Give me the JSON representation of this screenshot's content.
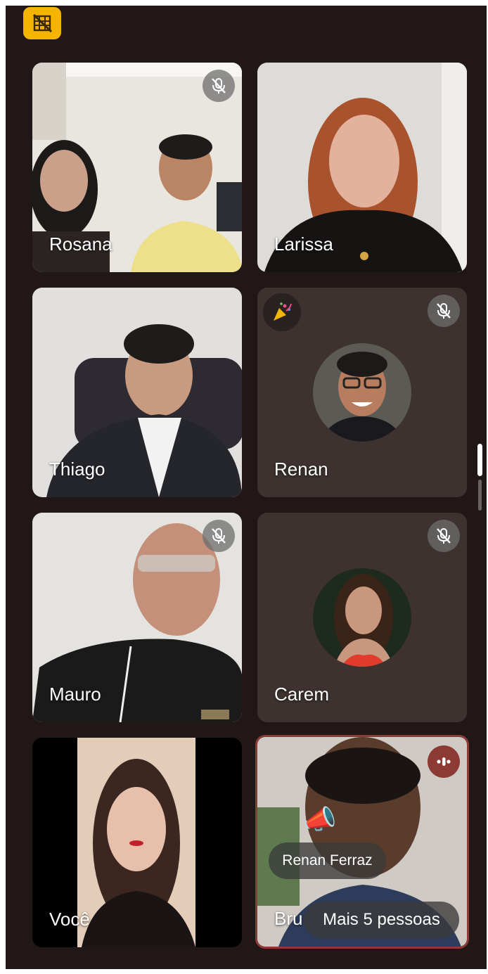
{
  "participants": [
    {
      "name": "Rosana",
      "muted": true
    },
    {
      "name": "Larissa",
      "muted": false
    },
    {
      "name": "Thiago",
      "muted": false
    },
    {
      "name": "Renan",
      "muted": true
    },
    {
      "name": "Mauro",
      "muted": true
    },
    {
      "name": "Carem",
      "muted": true
    },
    {
      "name": "Você",
      "muted": false
    },
    {
      "name": "Bru",
      "muted": false,
      "speaking": true
    }
  ],
  "reaction": {
    "sender": "Renan Ferraz",
    "emoji": "📣"
  },
  "more_people": "Mais 5 pessoas",
  "icons": {
    "top_badge": "camera-off-icon",
    "mute": "mic-off-icon",
    "audio": "audio-wave-icon",
    "reaction_btn": "party-popper-icon"
  },
  "colors": {
    "background": "#201716",
    "tile_empty": "#3d3230",
    "badge_yellow": "#f5b400",
    "speaking_border": "#8c3a33"
  }
}
